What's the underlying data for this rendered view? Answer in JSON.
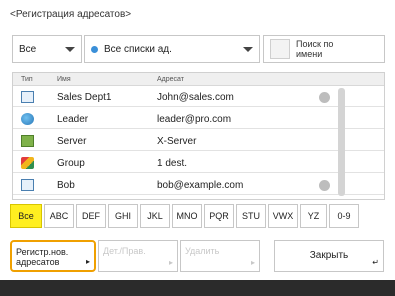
{
  "title": "<Регистрация адресатов>",
  "filters": {
    "type_value": "Все",
    "list_value": "Все списки ад.",
    "search_label": "Поиск по имени"
  },
  "table": {
    "columns": [
      "Тип",
      "Имя",
      "Адресат"
    ],
    "rows": [
      {
        "icon": "mail-icon",
        "name": "Sales Dept1",
        "address": "John@sales.com"
      },
      {
        "icon": "person-icon",
        "name": "Leader",
        "address": "leader@pro.com"
      },
      {
        "icon": "server-icon",
        "name": "Server",
        "address": "X-Server"
      },
      {
        "icon": "group-icon",
        "name": "Group",
        "address": "1 dest."
      },
      {
        "icon": "mail-icon",
        "name": "Bob",
        "address": "bob@example.com"
      }
    ]
  },
  "index_tabs": [
    "Все",
    "ABC",
    "DEF",
    "GHI",
    "JKL",
    "MNO",
    "PQR",
    "STU",
    "VWX",
    "YZ",
    "0-9"
  ],
  "active_index": 0,
  "actions": {
    "register_label": "Регистр.нов. адресатов",
    "details_label": "Дет./Прав.",
    "delete_label": "Удалить",
    "close_label": "Закрыть"
  },
  "accent_color": "#f0a000",
  "active_tab_color": "#ffef20"
}
